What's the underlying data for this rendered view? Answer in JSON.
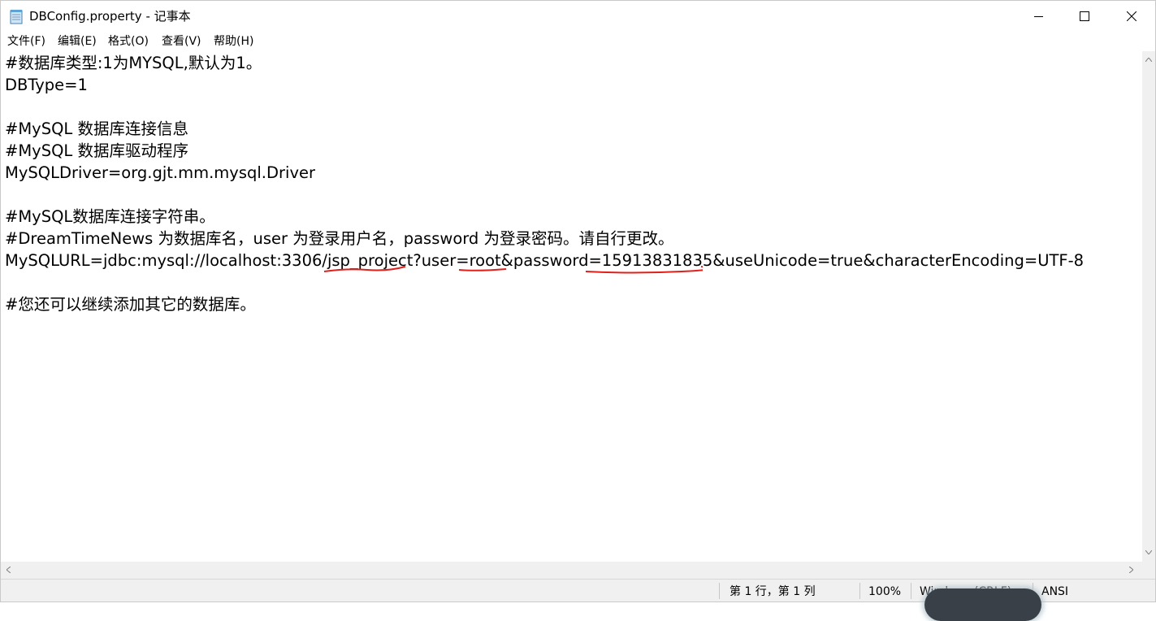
{
  "window": {
    "title": "DBConfig.property - 记事本",
    "icon": "notepad-icon"
  },
  "menu": [
    {
      "label": "文件(F)"
    },
    {
      "label": "编辑(E)"
    },
    {
      "label": "格式(O)"
    },
    {
      "label": "查看(V)"
    },
    {
      "label": "帮助(H)"
    }
  ],
  "editor": {
    "lines": [
      "#数据库类型:1为MYSQL,默认为1。",
      "DBType=1",
      "",
      "#MySQL 数据库连接信息",
      "#MySQL 数据库驱动程序",
      "MySQLDriver=org.gjt.mm.mysql.Driver",
      "",
      "#MySQL数据库连接字符串。",
      "#DreamTimeNews 为数据库名，user 为登录用户名，password 为登录密码。请自行更改。",
      "MySQLURL=jdbc:mysql://localhost:3306/jsp_project?user=root&password=15913831835&useUnicode=true&characterEncoding=UTF-8",
      "",
      "#您还可以继续添加其它的数据库。"
    ]
  },
  "status": {
    "position": "第 1 行，第 1 列",
    "zoom": "100%",
    "line_ending": "Windows (CRLF)",
    "encoding": "ANSI"
  },
  "colors": {
    "annotation": "#e0201b",
    "status_bg": "#f0f0f0"
  }
}
